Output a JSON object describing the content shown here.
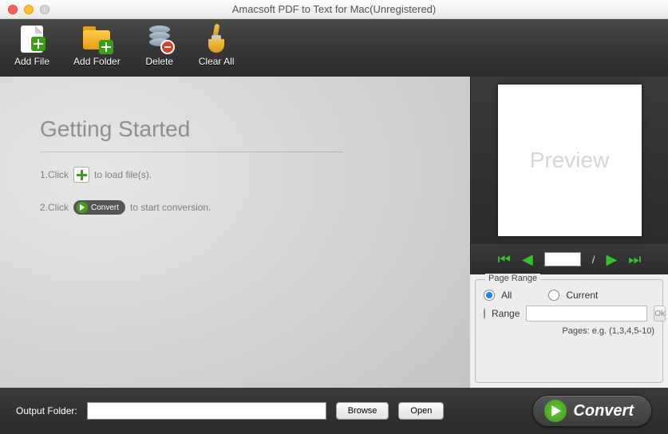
{
  "window": {
    "title": "Amacsoft PDF to Text for Mac(Unregistered)"
  },
  "toolbar": {
    "add_file": "Add File",
    "add_folder": "Add Folder",
    "delete": "Delete",
    "clear_all": "Clear All"
  },
  "getting_started": {
    "heading": "Getting Started",
    "step1_prefix": "1.Click",
    "step1_suffix": "to load file(s).",
    "step2_prefix": "2.Click",
    "step2_button": "Convert",
    "step2_suffix": "to start conversion."
  },
  "preview": {
    "placeholder": "Preview",
    "page_input": "",
    "page_sep": "/"
  },
  "page_range": {
    "legend": "Page Range",
    "all": "All",
    "current": "Current",
    "range": "Range",
    "range_value": "",
    "ok": "Ok",
    "hint": "Pages: e.g. (1,3,4,5-10)",
    "selected": "all"
  },
  "output": {
    "label": "Output Folder:",
    "value": "",
    "browse": "Browse",
    "open": "Open"
  },
  "convert": {
    "label": "Convert"
  }
}
